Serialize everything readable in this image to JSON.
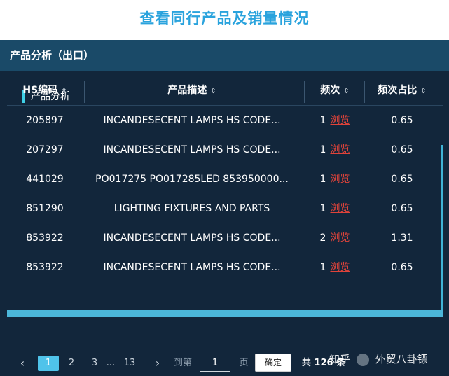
{
  "page_title": "查看同行产品及销量情况",
  "panel_header": "产品分析（出口）",
  "section_title": "产品分析",
  "table": {
    "columns": [
      "HS编码",
      "产品描述",
      "频次",
      "频次占比"
    ],
    "rows": [
      {
        "hs": "205897",
        "desc": "INCANDESECENT LAMPS HS CODE...",
        "freq": "1",
        "link": "浏览",
        "ratio": "0.65"
      },
      {
        "hs": "207297",
        "desc": "INCANDESECENT LAMPS HS CODE...",
        "freq": "1",
        "link": "浏览",
        "ratio": "0.65"
      },
      {
        "hs": "441029",
        "desc": "PO017275 PO017285LED 853950000...",
        "freq": "1",
        "link": "浏览",
        "ratio": "0.65"
      },
      {
        "hs": "851290",
        "desc": "LIGHTING FIXTURES AND PARTS",
        "freq": "1",
        "link": "浏览",
        "ratio": "0.65"
      },
      {
        "hs": "853922",
        "desc": "INCANDESECENT LAMPS HS CODE...",
        "freq": "2",
        "link": "浏览",
        "ratio": "1.31"
      },
      {
        "hs": "853922",
        "desc": "INCANDESECENT LAMPS HS CODE...",
        "freq": "1",
        "link": "浏览",
        "ratio": "0.65"
      }
    ]
  },
  "pagination": {
    "prev": "‹",
    "pages": [
      "1",
      "2",
      "3"
    ],
    "ellipsis": "...",
    "last_page": "13",
    "next": "›",
    "goto_label": "到第",
    "input_value": "1",
    "page_unit": "页",
    "confirm_label": "确定",
    "total": "共 126 条"
  },
  "watermark": {
    "brand": "知乎",
    "author": "外贸八卦镖"
  },
  "icons": {
    "sort": "sort-updown-icon",
    "prev": "chevron-left-icon",
    "next": "chevron-right-icon"
  }
}
